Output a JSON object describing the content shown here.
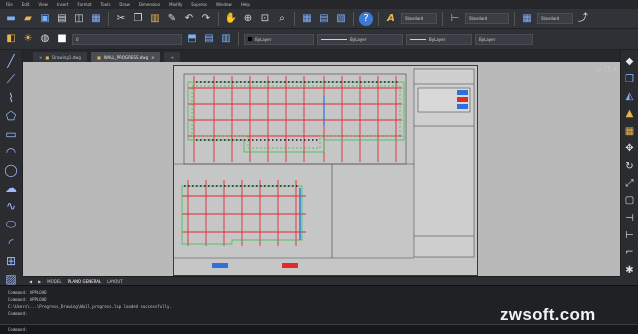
{
  "menu": [
    "File",
    "Edit",
    "View",
    "Insert",
    "Format",
    "Tools",
    "Draw",
    "Dimension",
    "Modify",
    "Express",
    "Window",
    "Help"
  ],
  "toolbar": {
    "layer_value": "ByLayer",
    "linetype_value": "ByLayer",
    "lineweight_value": "ByLayer",
    "text_style": "Standard",
    "dim_style": "Standard",
    "color_value": "ByLayer"
  },
  "tabs": [
    {
      "label": "Drawing1.dwg",
      "active": false
    },
    {
      "label": "WALL_PROGRESS.dwg",
      "active": true
    }
  ],
  "layout_tabs": [
    "MODEL",
    "PLANO GENERAL",
    "LAYOUT"
  ],
  "drawing": {
    "legend_left": "DONE",
    "legend_blue": "PENDIENTE",
    "legend_red": "EN PROCESO"
  },
  "command_history": [
    "Command: APPLOAD",
    "Command: APPLOAD",
    "C:\\Users\\...\\Progress_Drawing\\Wall_progress.lsp loaded successfully.",
    "Command:"
  ],
  "command_prompt": "Command:",
  "watermark": "zwsoft.com",
  "colors": {
    "background": "#2b2d31",
    "canvas": "#b9b9b9",
    "accent_blue": "#2f6fe0"
  }
}
